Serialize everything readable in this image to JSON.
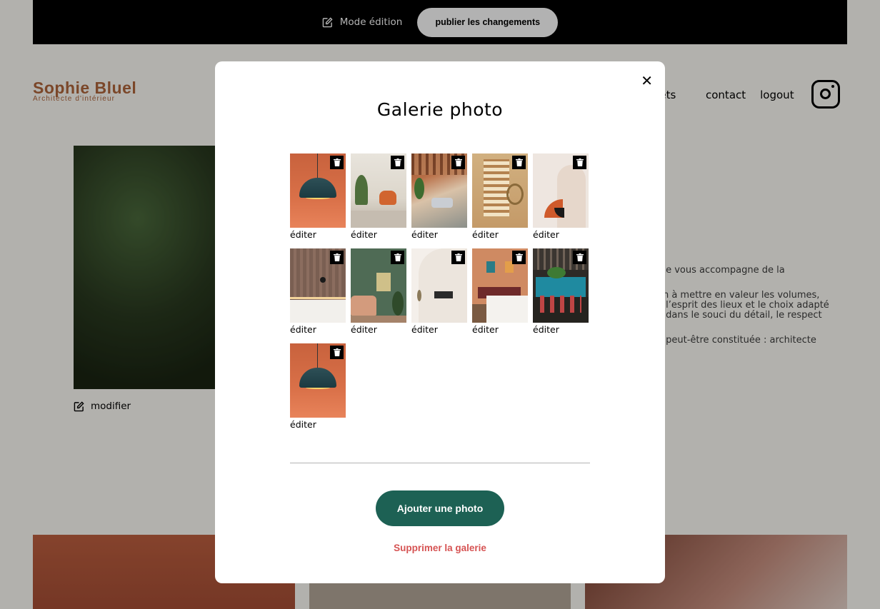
{
  "edit_bar": {
    "mode_label": "Mode édition",
    "publish_label": "publier les changements"
  },
  "header": {
    "logo_title": "Sophie Bluel",
    "logo_subtitle": "Architecte d'intérieur",
    "nav": [
      "projets",
      "contact",
      "logout"
    ],
    "nav_visible": [
      "ojets",
      "contact",
      "logout"
    ]
  },
  "intro": {
    "modify_label": "modifier",
    "text_fragments": [
      ". Je vous accompagne de la",
      "on à mettre en valeur les volumes,",
      "e l’esprit des lieux et le choix adapté",
      "é dans le souci du détail, le respect",
      "e peut-être constituée : architecte"
    ]
  },
  "modal": {
    "title": "Galerie photo",
    "close_symbol": "✕",
    "edit_label": "éditer",
    "photos": [
      {
        "art": "lamp"
      },
      {
        "art": "living"
      },
      {
        "art": "green"
      },
      {
        "art": "screen"
      },
      {
        "art": "arch"
      },
      {
        "art": "kitchen"
      },
      {
        "art": "sage"
      },
      {
        "art": "white"
      },
      {
        "art": "bed"
      },
      {
        "art": "bar"
      },
      {
        "art": "lamp"
      }
    ],
    "add_button": "Ajouter une photo",
    "delete_gallery": "Supprimer la galerie"
  },
  "colors": {
    "accent_green": "#1d6154",
    "brand_brown": "#b1663c",
    "danger_red": "#d65353"
  }
}
